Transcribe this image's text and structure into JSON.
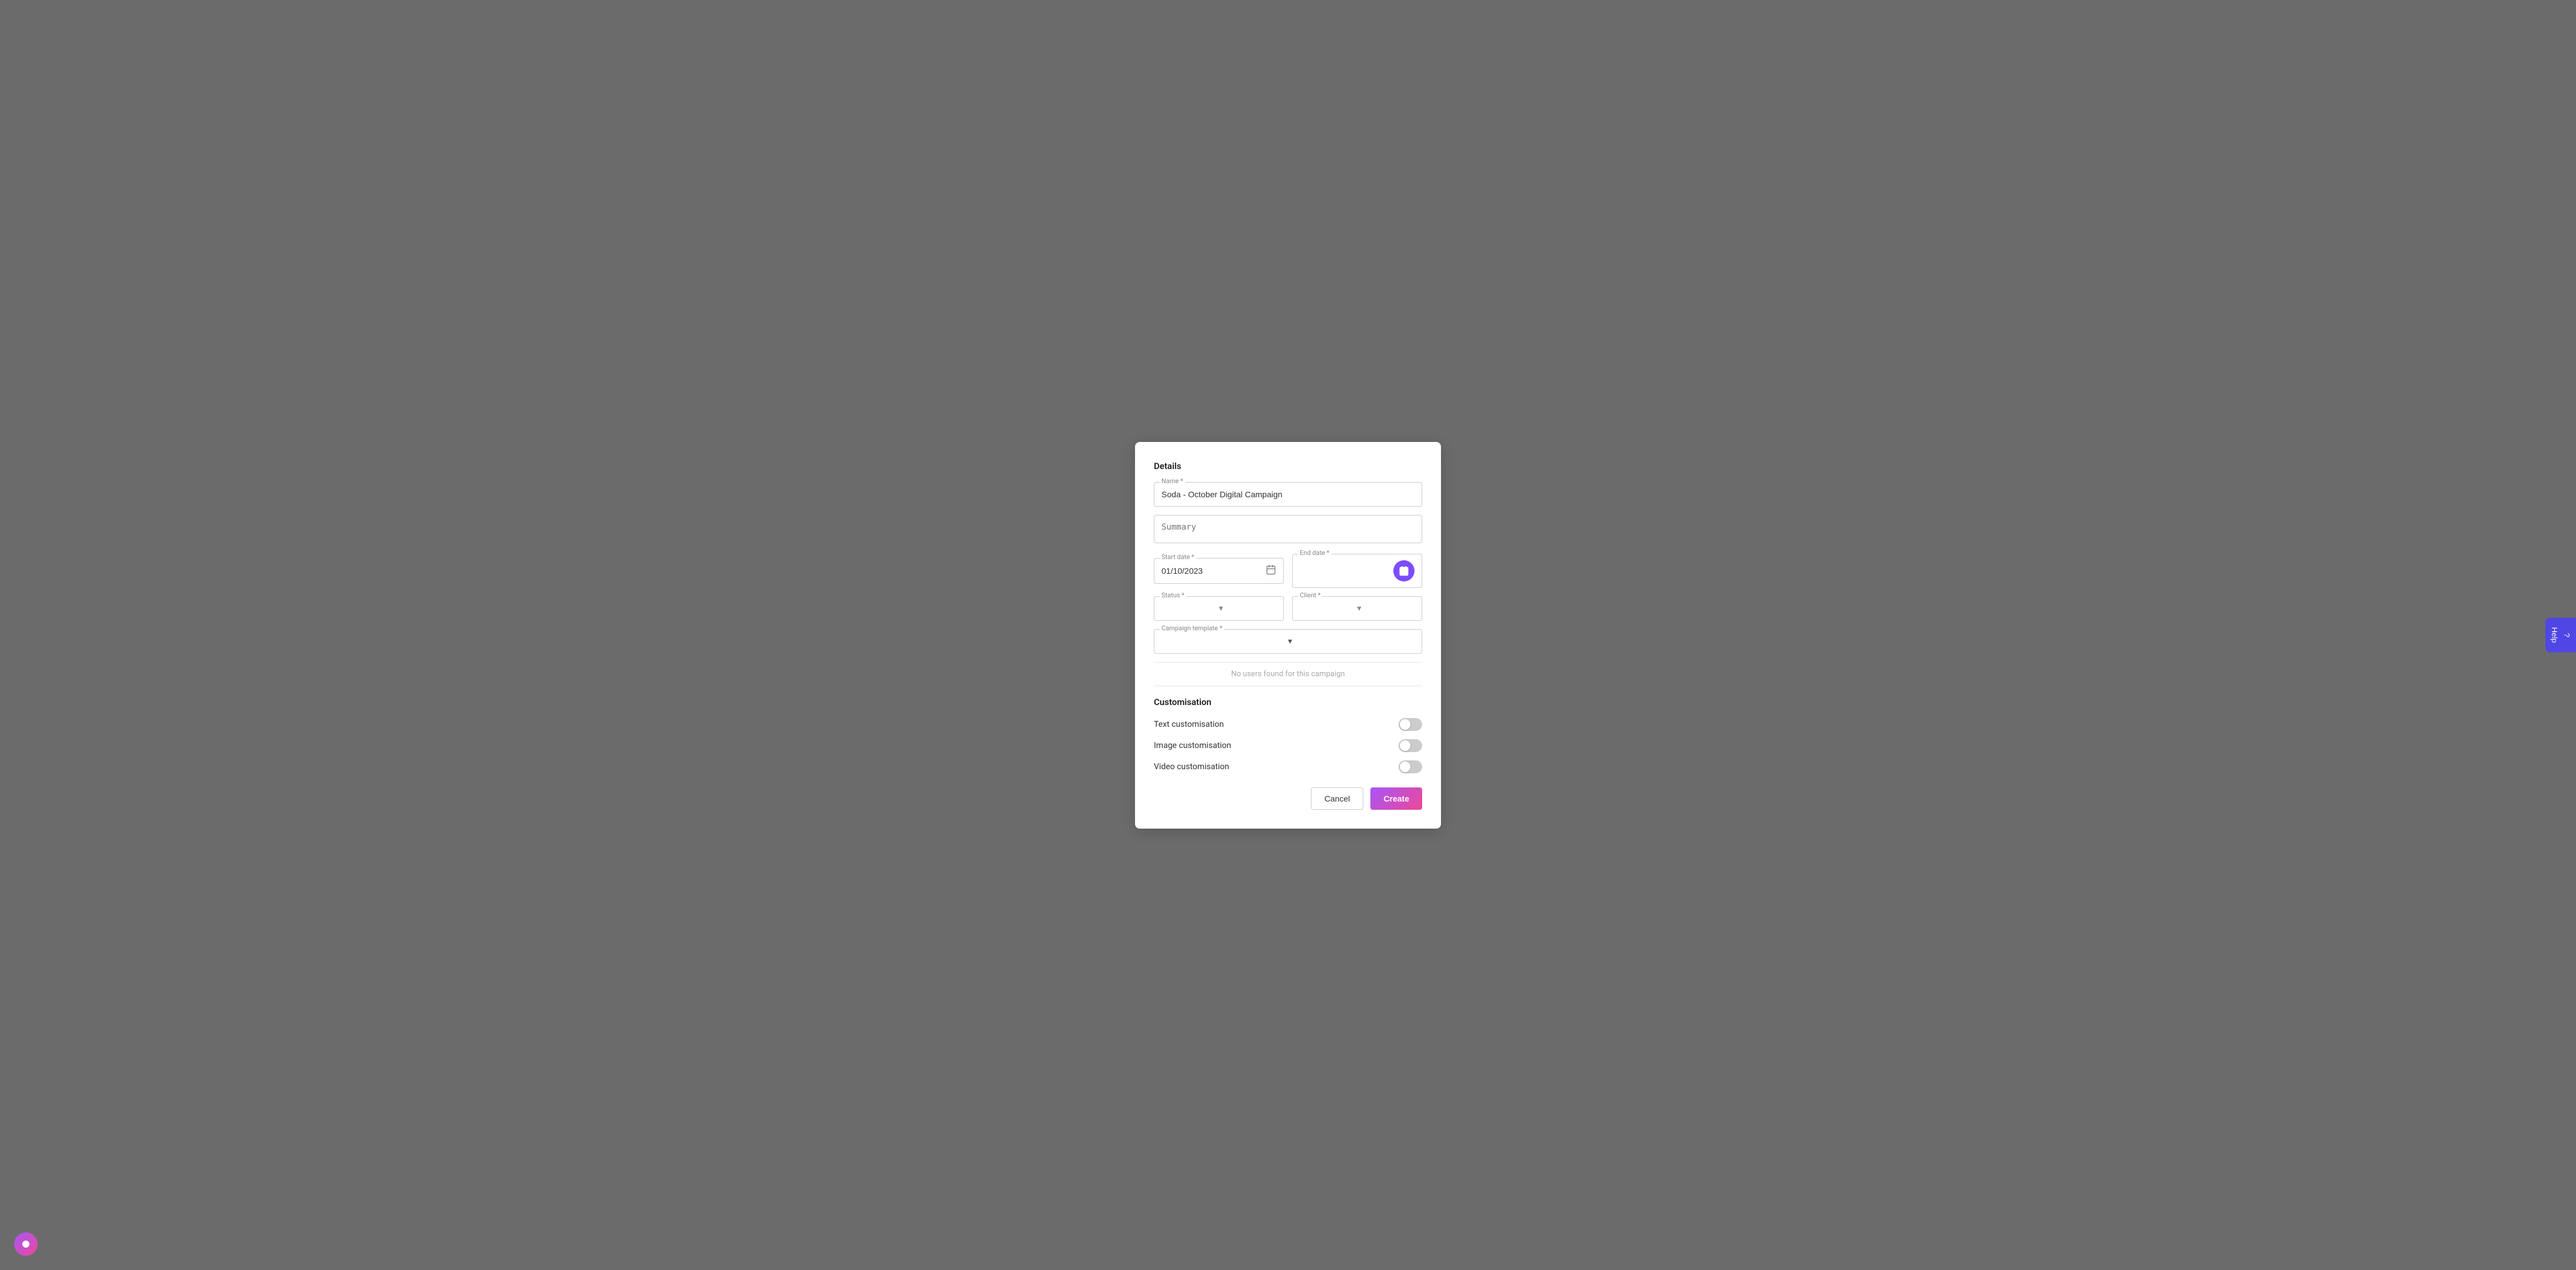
{
  "modal": {
    "details_section": "Details",
    "name_label": "Name *",
    "name_value": "Soda - October Digital Campaign",
    "summary_placeholder": "Summary",
    "start_date_label": "Start date *",
    "start_date_value": "01/10/2023",
    "end_date_label": "End date *",
    "end_date_value": "",
    "status_label": "Status *",
    "client_label": "Client *",
    "campaign_template_label": "Campaign template *",
    "no_users_msg": "No users found for this campaign",
    "customisation_section": "Customisation",
    "text_customisation_label": "Text customisation",
    "image_customisation_label": "Image customisation",
    "video_customisation_label": "Video customisation",
    "cancel_button": "Cancel",
    "create_button": "Create"
  },
  "help": {
    "label": "Help"
  },
  "icons": {
    "calendar": "📅",
    "chevron_down": "▾",
    "help": "?"
  }
}
